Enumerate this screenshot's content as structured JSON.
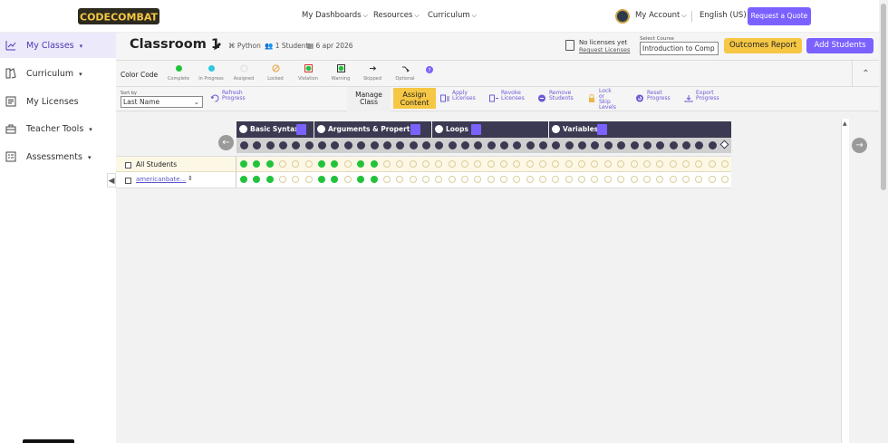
{
  "nav": {
    "links": [
      "My Dashboards",
      "Resources",
      "Curriculum"
    ],
    "account": "My Account",
    "language": "English (US)",
    "quote": "Request a Quote"
  },
  "sidebar": {
    "items": [
      {
        "label": "My Classes",
        "icon": "chart-icon",
        "active": true
      },
      {
        "label": "Curriculum",
        "icon": "book-icon"
      },
      {
        "label": "My Licenses",
        "icon": "license-icon"
      },
      {
        "label": "Teacher Tools",
        "icon": "toolbox-icon"
      },
      {
        "label": "Assessments",
        "icon": "clipboard-icon"
      }
    ]
  },
  "header": {
    "title": "Classroom 1",
    "language": "Python",
    "students": "1 Student",
    "date": "6 apr 2026",
    "licenses": "No licenses yet",
    "request_licenses": "Request Licenses",
    "course_label": "Select Course",
    "course_value": "Introduction to Comp",
    "outcomes": "Outcomes Report",
    "add_students": "Add Students"
  },
  "legend": {
    "title": "Color Code",
    "items": [
      {
        "label": "Complete",
        "color": "#22c33b"
      },
      {
        "label": "In Progress",
        "color": "#2ec8e0"
      },
      {
        "label": "Assigned",
        "color": "#dddddd"
      },
      {
        "label": "Locked",
        "color": "#e8a33b"
      },
      {
        "label": "Violation",
        "color": "#22c33b"
      },
      {
        "label": "Warning",
        "color": "#22c33b"
      },
      {
        "label": "Skipped",
        "color": "#333333"
      },
      {
        "label": "Optional",
        "color": "#333333"
      }
    ]
  },
  "actions": {
    "sort_label": "Sort by",
    "sort_value": "Last Name",
    "refresh": [
      "Refresh",
      "Progress"
    ],
    "manage": [
      "Manage",
      "Class"
    ],
    "assign": [
      "Assign",
      "Content"
    ],
    "apply": [
      "Apply",
      "Licenses"
    ],
    "revoke": [
      "Revoke",
      "Licenses"
    ],
    "remove": [
      "Remove",
      "Students"
    ],
    "lock": [
      "Lock or",
      "Skip",
      "Levels"
    ],
    "reset": [
      "Reset",
      "Progress"
    ],
    "export": [
      "Export",
      "Progress"
    ]
  },
  "modules": [
    {
      "name": "Basic Syntax"
    },
    {
      "name": "Arguments & Properties"
    },
    {
      "name": "Loops"
    },
    {
      "name": "Variables"
    }
  ],
  "rows": {
    "all": "All Students",
    "student": "americanbate..."
  }
}
